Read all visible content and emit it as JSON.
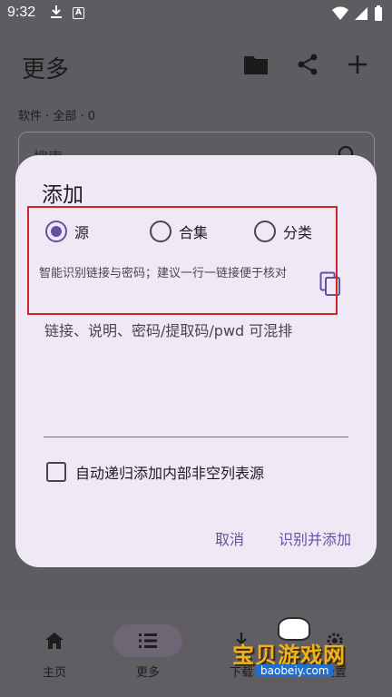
{
  "statusbar": {
    "time": "9:32",
    "extra_icon_letter": "A"
  },
  "app": {
    "title": "更多",
    "subinfo": "软件 · 全部 · 0",
    "search_placeholder": "搜索"
  },
  "bottom_nav": {
    "items": [
      {
        "label": "主页",
        "icon": "home-icon"
      },
      {
        "label": "更多",
        "icon": "list-icon",
        "active": true
      },
      {
        "label": "下载",
        "icon": "download-icon"
      },
      {
        "label": "设置",
        "icon": "settings-icon"
      }
    ]
  },
  "dialog": {
    "title": "添加",
    "radios": [
      {
        "label": "源",
        "checked": true
      },
      {
        "label": "合集",
        "checked": false
      },
      {
        "label": "分类",
        "checked": false
      }
    ],
    "hint": "智能识别链接与密码；建议一行一链接便于核对",
    "input_placeholder": "链接、说明、密码/提取码/pwd 可混排",
    "checkbox_label": "自动递归添加内部非空列表源",
    "checkbox_checked": false,
    "cancel_label": "取消",
    "confirm_label": "识别并添加"
  },
  "watermark": {
    "text": "宝贝游戏网",
    "url": "baobeiy.com"
  },
  "colors": {
    "accent": "#6750a4",
    "highlight_box": "#d0232a",
    "dialog_bg": "#efe9f5",
    "scrim": "#5d5c60"
  }
}
